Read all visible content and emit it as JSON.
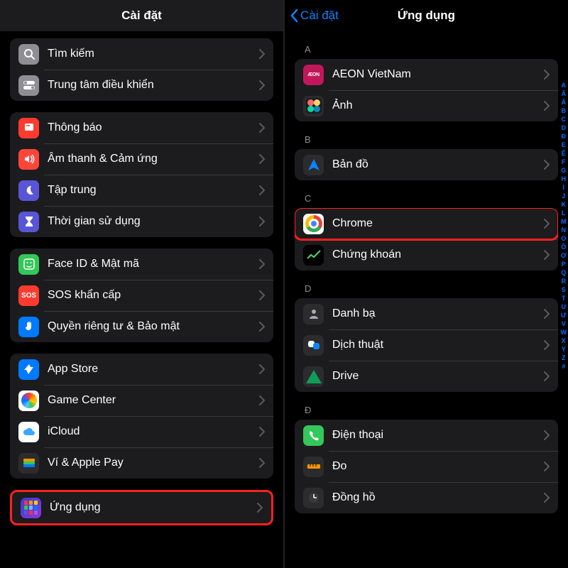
{
  "left": {
    "title": "Cài đặt",
    "group1": [
      {
        "key": "search",
        "label": "Tìm kiếm",
        "icon": "magnify",
        "bg": "bg-gray"
      },
      {
        "key": "control-center",
        "label": "Trung tâm điều khiển",
        "icon": "switches",
        "bg": "bg-gray"
      }
    ],
    "group2": [
      {
        "key": "notifications",
        "label": "Thông báo",
        "icon": "bell",
        "bg": "bg-red"
      },
      {
        "key": "sounds",
        "label": "Âm thanh & Cảm ứng",
        "icon": "speaker",
        "bg": "bg-redpink"
      },
      {
        "key": "focus",
        "label": "Tập trung",
        "icon": "moon",
        "bg": "bg-purple"
      },
      {
        "key": "screentime",
        "label": "Thời gian sử dụng",
        "icon": "hourglass",
        "bg": "bg-purple"
      }
    ],
    "group3": [
      {
        "key": "faceid",
        "label": "Face ID & Mật mã",
        "icon": "faceid",
        "bg": "bg-green"
      },
      {
        "key": "sos",
        "label": "SOS khẩn cấp",
        "icon": "sos",
        "bg": "bg-red"
      },
      {
        "key": "privacy",
        "label": "Quyền riêng tư & Bảo mật",
        "icon": "hand",
        "bg": "bg-blue"
      }
    ],
    "group4": [
      {
        "key": "appstore",
        "label": "App Store",
        "icon": "appstore",
        "bg": "bg-blue"
      },
      {
        "key": "gamecenter",
        "label": "Game Center",
        "icon": "gc",
        "bg": "bg-white"
      },
      {
        "key": "icloud",
        "label": "iCloud",
        "icon": "cloud",
        "bg": "bg-white"
      },
      {
        "key": "wallet",
        "label": "Ví & Apple Pay",
        "icon": "wallet",
        "bg": "bg-dark"
      }
    ],
    "group5": [
      {
        "key": "apps",
        "label": "Ứng dụng",
        "icon": "grid",
        "bg": "bg-grid"
      }
    ]
  },
  "right": {
    "back": "Cài đặt",
    "title": "Ứng dụng",
    "sections": [
      {
        "letter": "A",
        "items": [
          {
            "key": "aeon",
            "label": "AEON VietNam",
            "icon": "aeon",
            "bg": "bg-pink"
          },
          {
            "key": "photos",
            "label": "Ảnh",
            "icon": "photos",
            "bg": "bg-dark"
          }
        ]
      },
      {
        "letter": "B",
        "items": [
          {
            "key": "maps",
            "label": "Bản đồ",
            "icon": "maps",
            "bg": "bg-dark"
          }
        ]
      },
      {
        "letter": "C",
        "items": [
          {
            "key": "chrome",
            "label": "Chrome",
            "icon": "chrome",
            "bg": "bg-white",
            "highlighted": true
          },
          {
            "key": "stocks",
            "label": "Chứng khoán",
            "icon": "stocks",
            "bg": "bg-black"
          }
        ]
      },
      {
        "letter": "D",
        "items": [
          {
            "key": "contacts",
            "label": "Danh bạ",
            "icon": "contacts",
            "bg": "bg-dark"
          },
          {
            "key": "translate",
            "label": "Dịch thuật",
            "icon": "translate",
            "bg": "bg-dark"
          },
          {
            "key": "drive",
            "label": "Drive",
            "icon": "drive",
            "bg": "bg-dark"
          }
        ]
      },
      {
        "letter": "Đ",
        "items": [
          {
            "key": "phone",
            "label": "Điện thoại",
            "icon": "phone",
            "bg": "bg-green"
          },
          {
            "key": "measure",
            "label": "Đo",
            "icon": "ruler",
            "bg": "bg-dark"
          },
          {
            "key": "clock",
            "label": "Đồng hồ",
            "icon": "clock",
            "bg": "bg-dark"
          }
        ]
      }
    ],
    "index": [
      "A",
      "Ă",
      "Â",
      "B",
      "C",
      "D",
      "Đ",
      "E",
      "Ê",
      "F",
      "G",
      "H",
      "I",
      "J",
      "K",
      "L",
      "M",
      "N",
      "O",
      "Ô",
      "Ơ",
      "P",
      "Q",
      "R",
      "S",
      "T",
      "U",
      "Ư",
      "V",
      "W",
      "X",
      "Y",
      "Z",
      "#"
    ]
  }
}
